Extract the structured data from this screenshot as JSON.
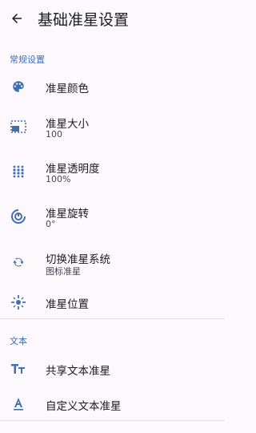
{
  "header": {
    "title": "基础准星设置"
  },
  "sections": [
    {
      "label": "常规设置",
      "items": [
        {
          "label": "准星颜色",
          "icon": "palette-icon"
        },
        {
          "label": "准星大小",
          "value": "100",
          "icon": "size-frame-icon"
        },
        {
          "label": "准星透明度",
          "value": "100%",
          "icon": "opacity-dots-icon"
        },
        {
          "label": "准星旋转",
          "value": "0°",
          "icon": "rotation-icon"
        },
        {
          "label": "切换准星系统",
          "value": "图标准星",
          "icon": "switch-icon"
        },
        {
          "label": "准星位置",
          "icon": "position-icon"
        }
      ]
    },
    {
      "label": "文本",
      "items": [
        {
          "label": "共享文本准星",
          "icon": "text-size-icon"
        },
        {
          "label": "自定义文本准星",
          "icon": "text-format-icon"
        }
      ]
    }
  ],
  "colors": {
    "accent": "#3f6fb2",
    "icon": "#3f6fb2",
    "background": "#fcf8fc",
    "divider": "#e3dfe6"
  }
}
